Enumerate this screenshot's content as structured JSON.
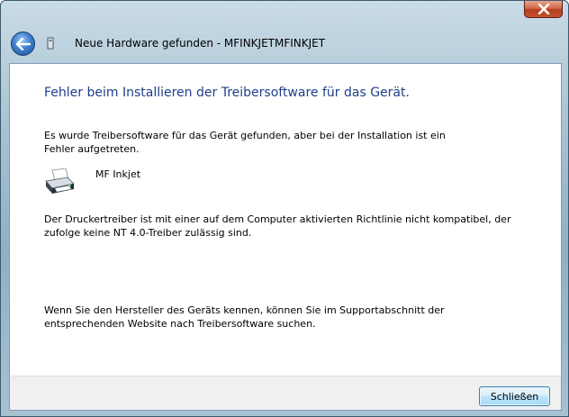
{
  "window": {
    "title": "Neue Hardware gefunden - MFINKJETMFINKJET",
    "close_label": "×"
  },
  "main": {
    "heading": "Fehler beim Installieren der Treibersoftware für das Gerät.",
    "intro": "Es wurde Treibersoftware für das Gerät gefunden, aber bei der Installation ist ein Fehler aufgetreten.",
    "device_name": "MF Inkjet",
    "error_detail": "Der Druckertreiber ist mit einer auf dem Computer aktivierten Richtlinie nicht kompatibel, der zufolge keine NT 4.0-Treiber zulässig sind.",
    "hint": "Wenn Sie den Hersteller des Geräts kennen, können Sie im Supportabschnitt der entsprechenden Website nach Treibersoftware suchen."
  },
  "footer": {
    "close_button_label": "Schließen"
  },
  "icons": {
    "back": "back-arrow-icon",
    "close": "close-icon",
    "device": "printer-icon",
    "title": "hardware-icon"
  },
  "colors": {
    "heading": "#1f3f8a",
    "frame": "#a9c2d2",
    "close_button": "#c4512f"
  }
}
